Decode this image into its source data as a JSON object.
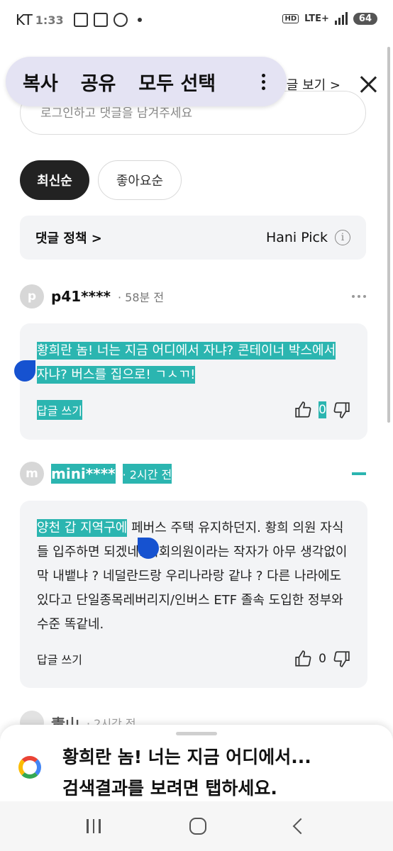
{
  "status_bar": {
    "carrier": "KT",
    "time": "1:33",
    "hd": "HD",
    "network": "LTE+",
    "battery": "64"
  },
  "context_menu": {
    "copy": "복사",
    "share": "공유",
    "select_all": "모두 선택"
  },
  "header": {
    "more_link": "글 보기 >"
  },
  "comment_input": {
    "placeholder": "로그인하고 댓글을 남겨주세요"
  },
  "sort": {
    "latest": "최신순",
    "popular": "좋아요순"
  },
  "policy": {
    "link": "댓글 정책 >",
    "pick": "Hani Pick",
    "info": "i"
  },
  "comments": [
    {
      "avatar": "p",
      "author": "p41****",
      "time": "· 58분 전",
      "text": "황희란 놈! 너는 지금 어디에서 자냐? 콘테이너 박스에서 자냐? 버스를 집으로! ㄱㅅㄲ!",
      "reply": "답글 쓰기",
      "likes": "0"
    },
    {
      "avatar": "m",
      "author": "mini****",
      "time": "· 2시간 전",
      "text_highlight": "양천 갑 지역구에",
      "text_rest": " 페버스 주택 유지하던지. 황희 의원 자식들 입주하면 되겠네. 국회의원이라는 작자가 아무 생각없이 막 내뱉냐 ? 네덜란드랑 우리나라랑 같냐 ? 다른 나라에도 있다고 단일종목레버리지/인버스 ETF 졸속 도입한 정부와 수준 똑같네.",
      "reply": "답글 쓰기",
      "likes": "0"
    }
  ],
  "partial_comment": {
    "author": "靑山",
    "time": "· 2시간 전"
  },
  "google_sheet": {
    "title": "황희란 놈! 너는 지금 어디에서...",
    "subtitle": "검색결과를 보려면 탭하세요."
  },
  "colors": {
    "highlight": "#2bb5b0",
    "handle": "#1652d0",
    "menu_bg": "#e4e3f3"
  }
}
